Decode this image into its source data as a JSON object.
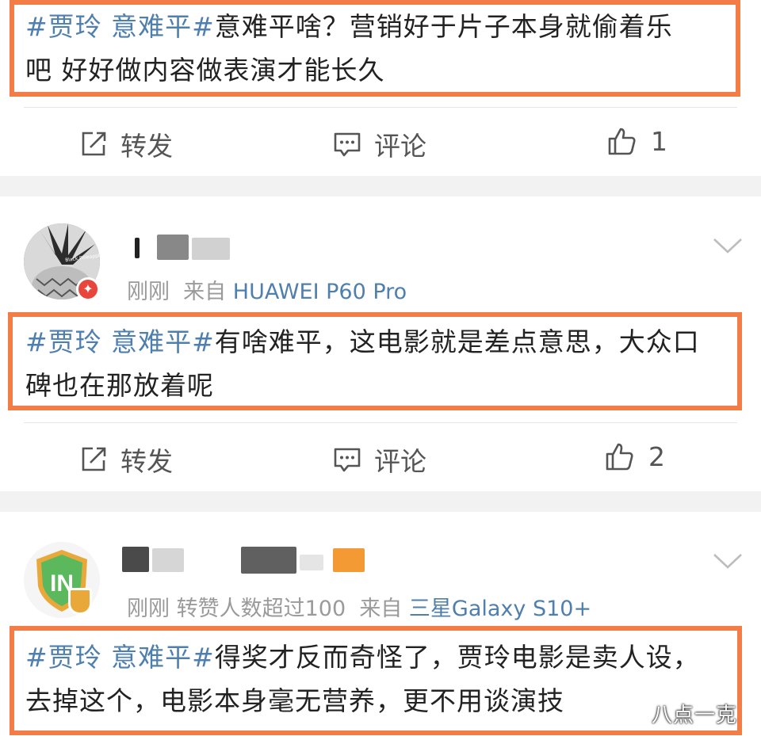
{
  "posts": [
    {
      "tag": "#贾玲 意难平#",
      "line1_rest": "意难平啥？营销好于片子本身就偷着乐",
      "line2": "吧  好好做内容做表演才能长久",
      "actions": {
        "repost": "转发",
        "comment": "评论",
        "like_count": "1"
      }
    },
    {
      "avatar_text": "Black Pineapple",
      "time": "刚刚",
      "from_label": "来自",
      "device": "HUAWEI P60 Pro",
      "tag": "#贾玲 意难平#",
      "line1_rest": "有啥难平，这电影就是差点意思，大众口",
      "line2": "碑也在那放着呢",
      "actions": {
        "repost": "转发",
        "comment": "评论",
        "like_count": "2"
      }
    },
    {
      "time": "刚刚",
      "likes_info": "转赞人数超过100",
      "from_label": "来自",
      "device": "三星Galaxy S10+",
      "tag": "#贾玲 意难平#",
      "line1_rest": "得奖才反而奇怪了，贾玲电影是卖人设，",
      "line2": "去掉这个，电影本身毫无营养，更不用谈演技"
    }
  ],
  "watermark": "八点一克",
  "colors": {
    "highlight": "#f47c47",
    "link": "#4f7fae",
    "separator": "#f2f2f2"
  }
}
